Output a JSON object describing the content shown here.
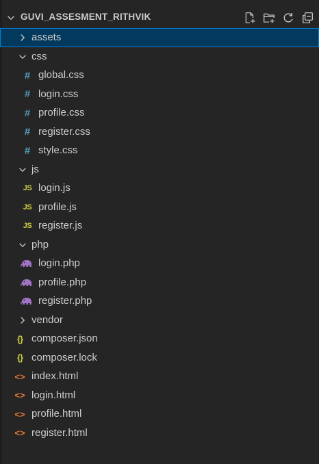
{
  "explorer": {
    "title": "GUVI_ASSESMENT_RITHVIK",
    "actions": [
      {
        "name": "new-file-icon"
      },
      {
        "name": "new-folder-icon"
      },
      {
        "name": "refresh-icon"
      },
      {
        "name": "collapse-all-icon"
      }
    ]
  },
  "tree": {
    "assets": "assets",
    "css": "css",
    "css_files": [
      "global.css",
      "login.css",
      "profile.css",
      "register.css",
      "style.css"
    ],
    "js": "js",
    "js_files": [
      "login.js",
      "profile.js",
      "register.js"
    ],
    "php": "php",
    "php_files": [
      "login.php",
      "profile.php",
      "register.php"
    ],
    "vendor": "vendor",
    "root_files": [
      "composer.json",
      "composer.lock",
      "index.html",
      "login.html",
      "profile.html",
      "register.html"
    ]
  },
  "icons": {
    "css_glyph": "#",
    "js_glyph": "JS",
    "json_glyph": "{}",
    "html_glyph": "<>"
  },
  "colors": {
    "background": "#252526",
    "selection": "#04395e",
    "selection_border": "#007fd4",
    "css_icon": "#519aba",
    "js_icon": "#cbcb41",
    "json_icon": "#cbcb41",
    "html_icon": "#e37933",
    "php_icon": "#a074c4"
  }
}
